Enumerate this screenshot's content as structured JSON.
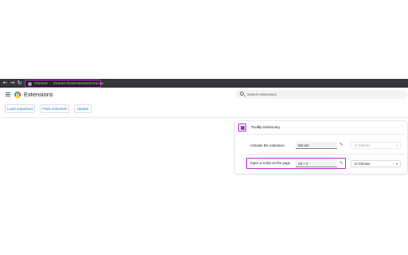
{
  "browser": {
    "url_prefix": "Chrome",
    "url_separator": "|",
    "url_text": "chrome://extensions/shortcuts",
    "highlight_color": "#c026d3"
  },
  "header": {
    "title": "Extensions",
    "search_placeholder": "Search extensions"
  },
  "toolbar": {
    "load_unpacked": "Load unpacked",
    "pack_extension": "Pack extension",
    "update": "Update"
  },
  "extension": {
    "name": "Tooltip Dictionary",
    "shortcuts": [
      {
        "label": "Activate the extension",
        "shortcut": "Not set",
        "scope": "In Chrome",
        "scope_disabled": true
      },
      {
        "label": "Inject a script on the page",
        "shortcut": "Alt + V",
        "scope": "In Chrome",
        "scope_disabled": false
      }
    ]
  },
  "icons": [
    "back-icon",
    "forward-icon",
    "reload-icon",
    "lock-icon",
    "menu-icon",
    "chrome-logo-icon",
    "search-icon",
    "extension-icon",
    "edit-icon",
    "chevron-down-icon"
  ]
}
